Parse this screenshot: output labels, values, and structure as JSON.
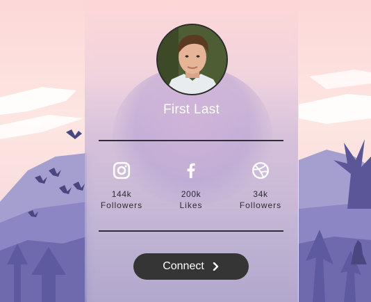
{
  "profile": {
    "name": "First Last"
  },
  "stats": [
    {
      "icon": "instagram-icon",
      "count": "144k",
      "label": "Followers"
    },
    {
      "icon": "facebook-icon",
      "count": "200k",
      "label": "Likes"
    },
    {
      "icon": "dribbble-icon",
      "count": "34k",
      "label": "Followers"
    }
  ],
  "actions": {
    "connect_label": "Connect"
  },
  "colors": {
    "button_bg": "#353535",
    "divider": "#2e2e36",
    "sky_top": "#fcdcdc",
    "mountain": "#8c86c4"
  }
}
